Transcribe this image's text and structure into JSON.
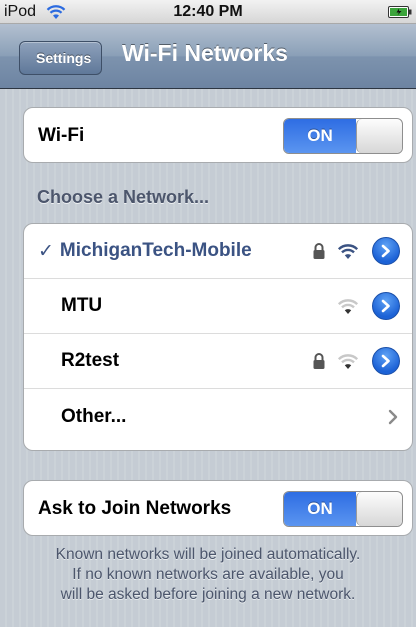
{
  "statusbar": {
    "carrier": "iPod",
    "time": "12:40 PM",
    "wifi_icon": "wifi-icon",
    "battery_icon": "battery-icon"
  },
  "navbar": {
    "back_label": "Settings",
    "title": "Wi-Fi Networks"
  },
  "wifi_cell": {
    "label": "Wi-Fi",
    "toggle_label": "ON"
  },
  "networks_header": "Choose a Network...",
  "networks": [
    {
      "name": "MichiganTech-Mobile",
      "checkmark": "✓",
      "selected": true,
      "locked": true,
      "signal": "full"
    },
    {
      "name": "MTU",
      "selected": false,
      "locked": false,
      "signal": "weak"
    },
    {
      "name": "R2test",
      "selected": false,
      "locked": true,
      "signal": "weak"
    },
    {
      "name": "Other...",
      "selected": false,
      "disclosure": "chevron"
    }
  ],
  "ask_cell": {
    "label": "Ask to Join Networks",
    "toggle_label": "ON"
  },
  "footer": {
    "line1": "Known networks will be joined automatically.",
    "line2": "If no known networks are available, you",
    "line3": "will be asked before joining a new network."
  },
  "colors": {
    "toggle_on": "#2e6de3",
    "selected_text": "#3b5383",
    "navbar": "#6d84a2"
  }
}
